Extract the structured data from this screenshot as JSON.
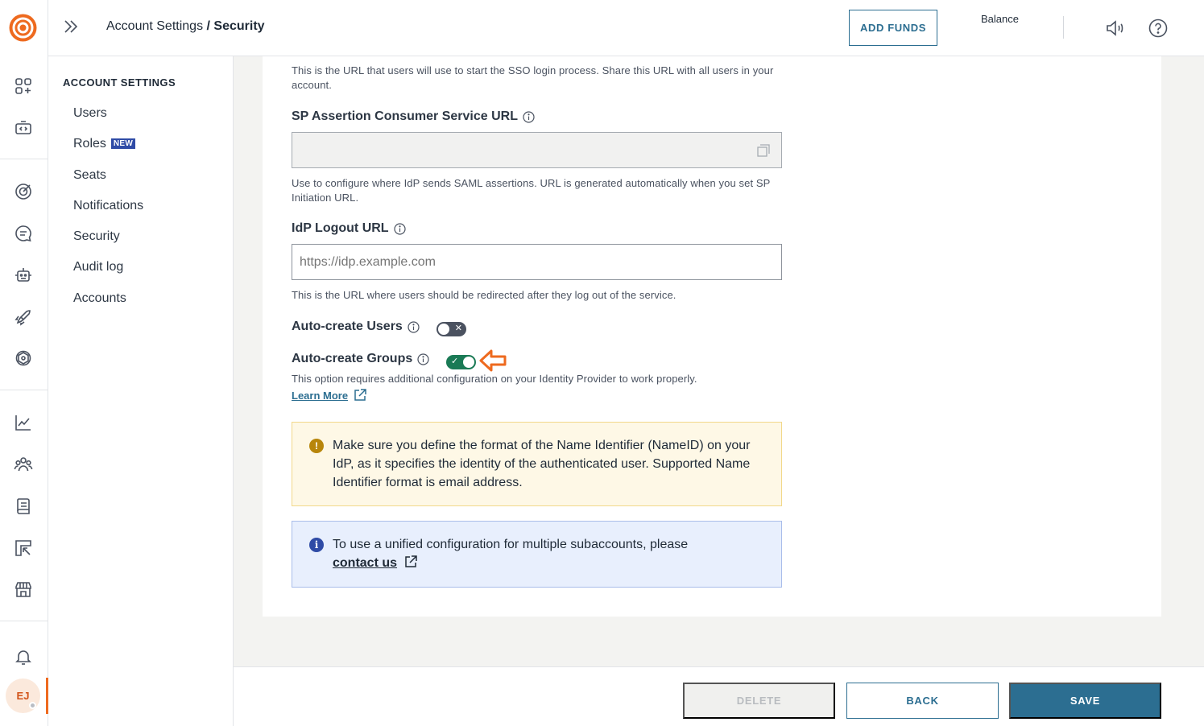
{
  "header": {
    "breadcrumb_parent": "Account Settings",
    "breadcrumb_sep": " / ",
    "breadcrumb_current": "Security",
    "add_funds_label": "ADD FUNDS",
    "balance_label": "Balance"
  },
  "user": {
    "initials": "EJ"
  },
  "settings_nav": {
    "heading": "ACCOUNT SETTINGS",
    "items": [
      {
        "label": "Users"
      },
      {
        "label": "Roles",
        "badge": "NEW"
      },
      {
        "label": "Seats"
      },
      {
        "label": "Notifications"
      },
      {
        "label": "Security"
      },
      {
        "label": "Audit log"
      },
      {
        "label": "Accounts"
      }
    ]
  },
  "form": {
    "sp_initiation_help": "This is the URL that users will use to start the SSO login process. Share this URL with all users in your account.",
    "acs_label": "SP Assertion Consumer Service URL",
    "acs_value": "",
    "acs_help": "Use to configure where IdP sends SAML assertions. URL is generated automatically when you set SP Initiation URL.",
    "logout_label": "IdP Logout URL",
    "logout_placeholder": "https://idp.example.com",
    "logout_value": "",
    "logout_help": "This is the URL where users should be redirected after they log out of the service.",
    "auto_users_label": "Auto-create Users",
    "auto_users_enabled": false,
    "auto_groups_label": "Auto-create Groups",
    "auto_groups_enabled": true,
    "auto_groups_help": "This option requires additional configuration on your Identity Provider to work properly.",
    "learn_more": "Learn More"
  },
  "alerts": {
    "warning_text": "Make sure you define the format of the Name Identifier (NameID) on your IdP, as it specifies the identity of the authenticated user. Supported Name Identifier format is email address.",
    "info_text": "To use a unified configuration for multiple subaccounts, please",
    "info_link": "contact us"
  },
  "footer": {
    "delete_label": "DELETE",
    "back_label": "BACK",
    "save_label": "SAVE"
  },
  "colors": {
    "brand": "#ee6a1f",
    "primary": "#2c6e91",
    "toggle_on": "#1a7a55",
    "warning_bg": "#fef8e6",
    "info_bg": "#e8effd"
  }
}
